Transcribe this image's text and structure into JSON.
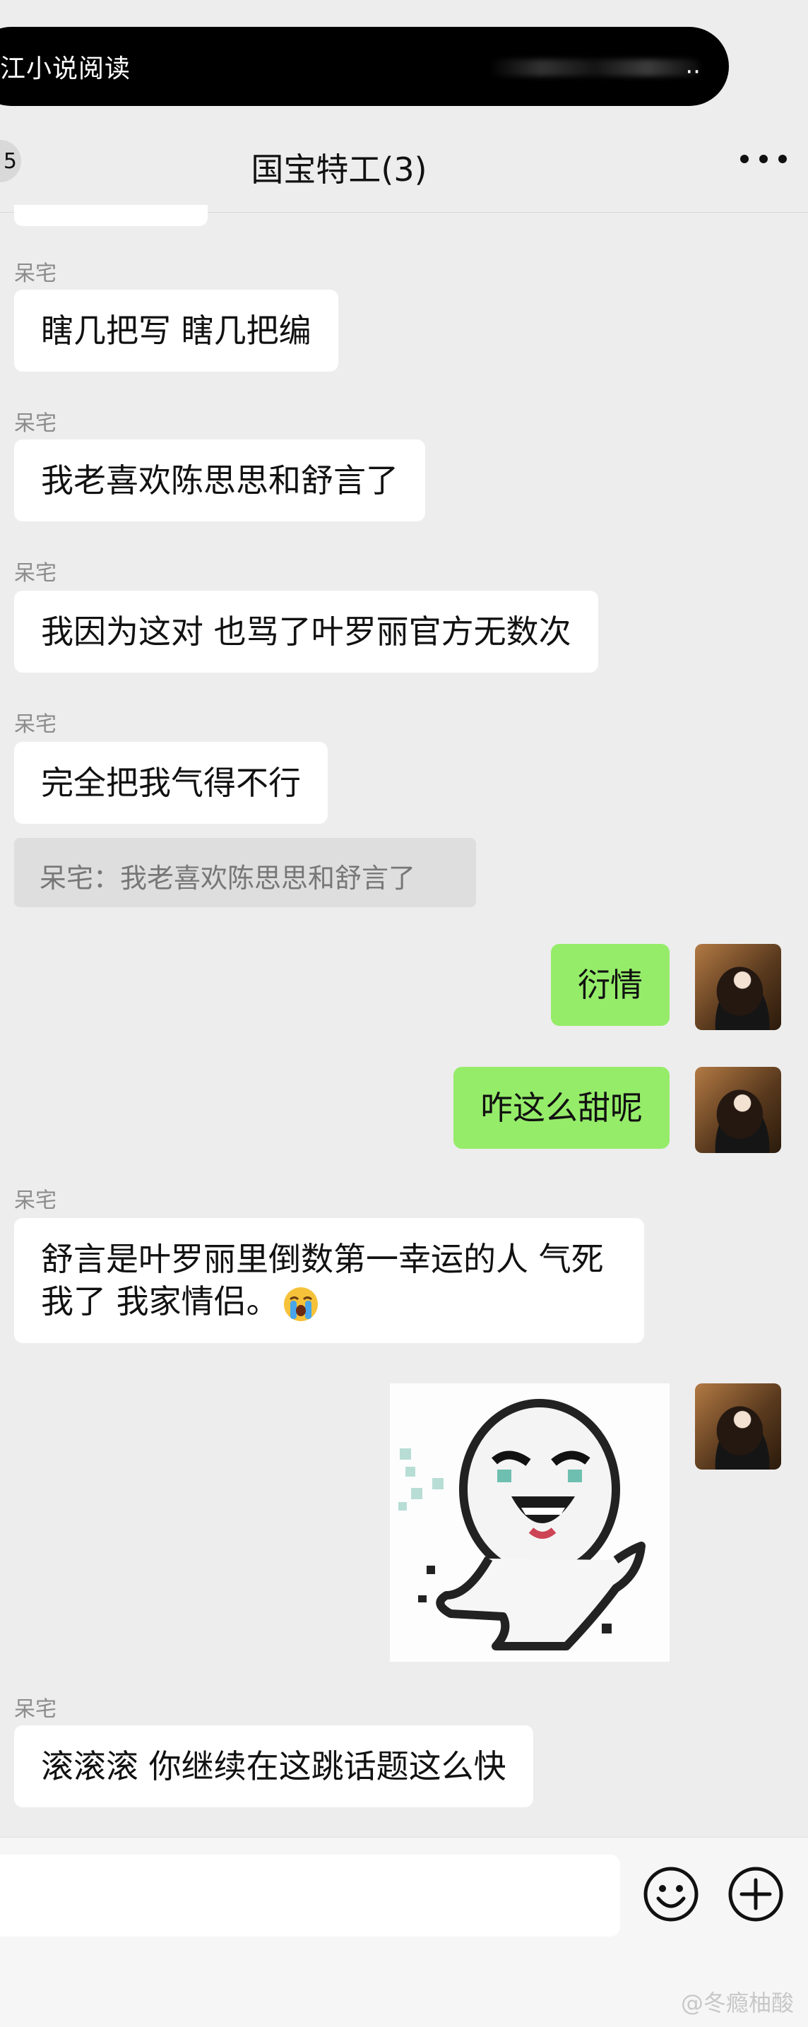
{
  "notification": {
    "text": "江小说阅读",
    "more": "··"
  },
  "header": {
    "unread": "5",
    "title": "国宝特工(3)"
  },
  "messages": [
    {
      "sender": "呆宅",
      "text": "瞎几把写 瞎几把编"
    },
    {
      "sender": "呆宅",
      "text": "我老喜欢陈思思和舒言了"
    },
    {
      "sender": "呆宅",
      "text": "我因为这对 也骂了叶罗丽官方无数次"
    },
    {
      "sender": "呆宅",
      "text": "完全把我气得不行"
    },
    {
      "quote": "呆宅：我老喜欢陈思思和舒言了"
    },
    {
      "self": true,
      "text": "衍情"
    },
    {
      "self": true,
      "text": "咋这么甜呢"
    },
    {
      "sender": "呆宅",
      "text": "舒言是叶罗丽里倒数第一幸运的人 气死我了 我家情侣。"
    },
    {
      "self": true,
      "sticker": "laughing-ghost-sticker"
    },
    {
      "sender": "呆宅",
      "text": "滚滚滚 你继续在这跳话题这么快"
    }
  ],
  "watermark": "@冬瘾柚酸"
}
